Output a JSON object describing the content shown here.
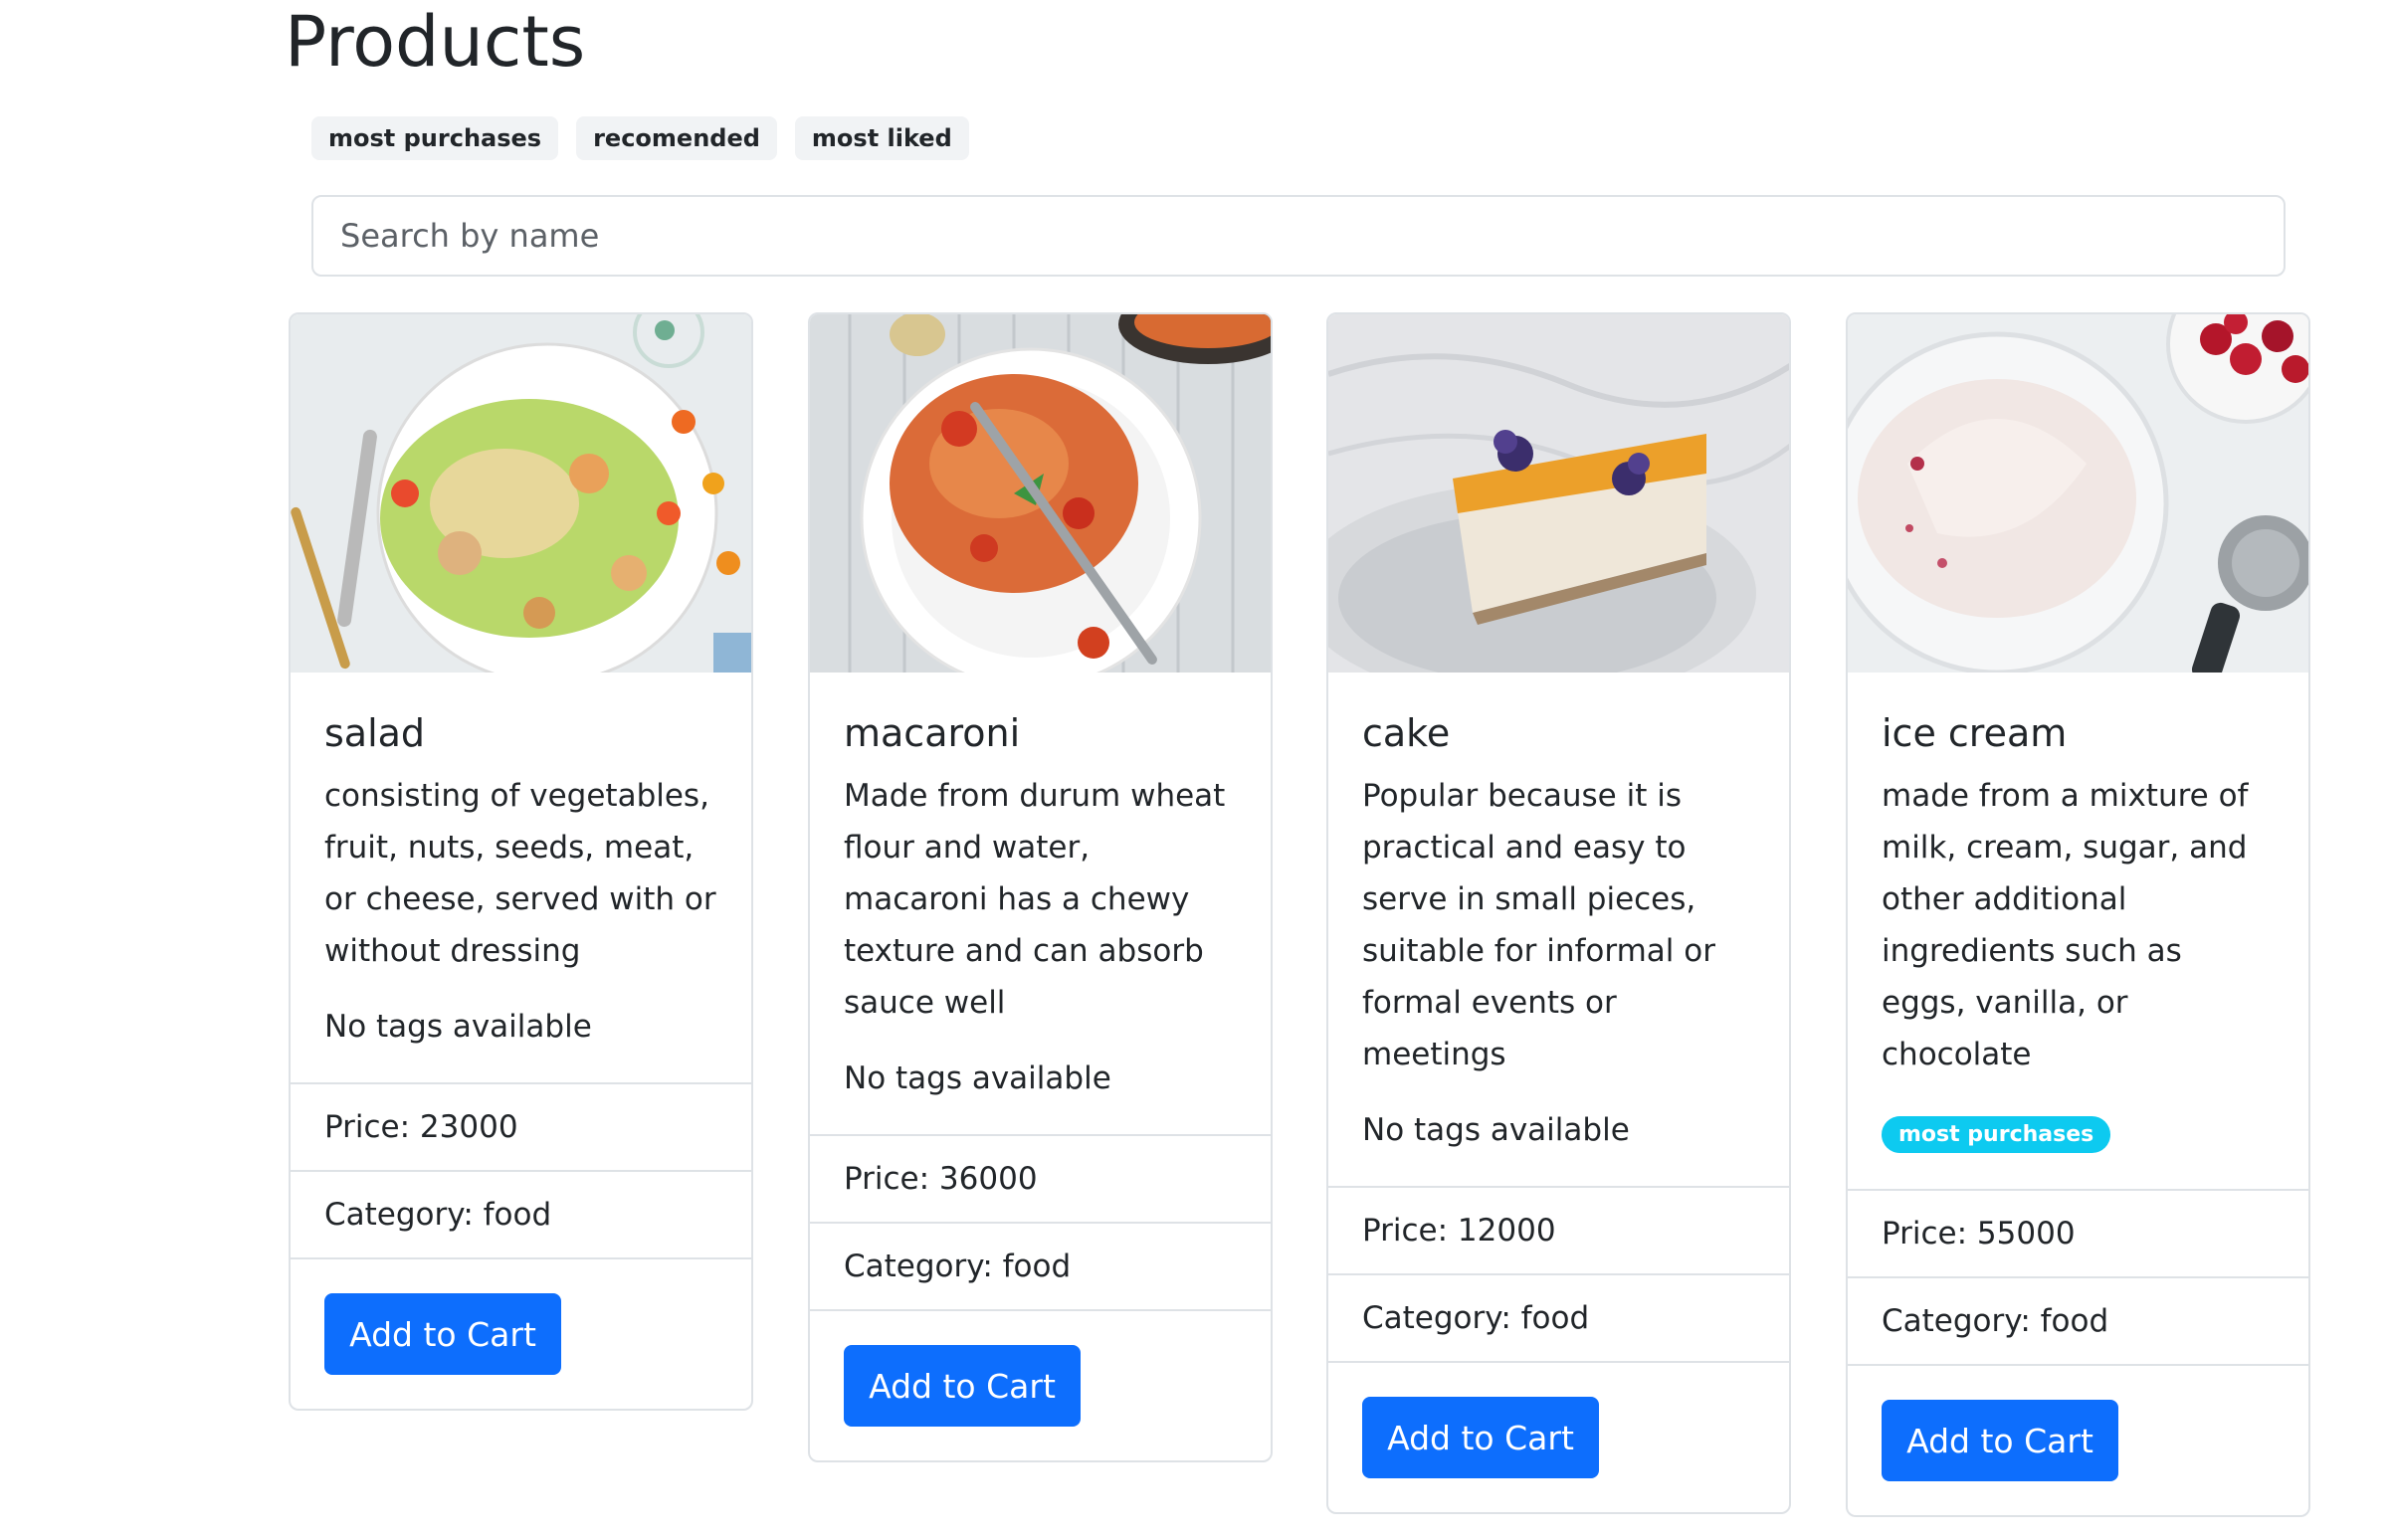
{
  "page": {
    "title": "Products"
  },
  "filters": [
    {
      "label": "most purchases"
    },
    {
      "label": "recomended"
    },
    {
      "label": "most liked"
    }
  ],
  "search": {
    "placeholder": "Search by name",
    "value": ""
  },
  "products": [
    {
      "name": "salad",
      "description": "consisting of vegetables, fruit, nuts, seeds, meat, or cheese, served with or without dressing",
      "tags_text": "No tags available",
      "price": "Price: 23000",
      "category": "Category: food",
      "button": "Add to Cart"
    },
    {
      "name": "macaroni",
      "description": "Made from durum wheat flour and water, macaroni has a chewy texture and can absorb sauce well",
      "tags_text": "No tags available",
      "price": "Price: 36000",
      "category": "Category: food",
      "button": "Add to Cart"
    },
    {
      "name": "cake",
      "description": "Popular because it is practical and easy to serve in small pieces, suitable for informal or formal events or meetings",
      "tags_text": "No tags available",
      "price": "Price: 12000",
      "category": "Category: food",
      "button": "Add to Cart"
    },
    {
      "name": "ice cream",
      "description": "made from a mixture of milk, cream, sugar, and other additional ingredients such as eggs, vanilla, or chocolate",
      "tag": "most purchases",
      "price": "Price: 55000",
      "category": "Category: food",
      "button": "Add to Cart"
    }
  ],
  "colors": {
    "primary_button": "#0d6efd",
    "tag_badge": "#0dcaf0",
    "border": "#dee2e6",
    "filter_bg": "#f1f3f5"
  }
}
